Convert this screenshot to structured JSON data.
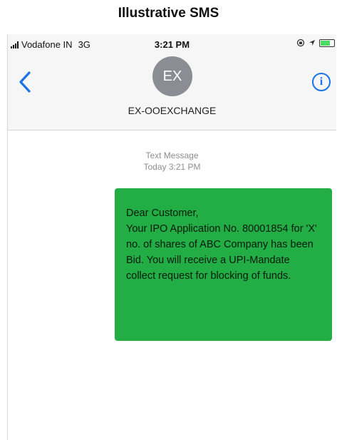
{
  "caption": "Illustrative SMS",
  "status_bar": {
    "carrier": "Vodafone IN",
    "network": "3G",
    "time": "3:21 PM"
  },
  "header": {
    "back_icon": "chevron-left-icon",
    "avatar_initials": "EX",
    "contact_name": "EX-OOEXCHANGE",
    "info_icon": "info-icon",
    "info_glyph": "i"
  },
  "thread": {
    "message_type": "Text Message",
    "timestamp": "Today 3:21 PM"
  },
  "message": {
    "greeting": "Dear Customer,",
    "body": "Your IPO Application No. 80001854 for 'X' no. of shares of ABC Company has been Bid. You will receive a UPI-Mandate collect request for blocking of funds."
  },
  "colors": {
    "bubble": "#22ad45",
    "accent": "#1a73e8",
    "avatar": "#8a8d93",
    "battery": "#4cd964"
  }
}
